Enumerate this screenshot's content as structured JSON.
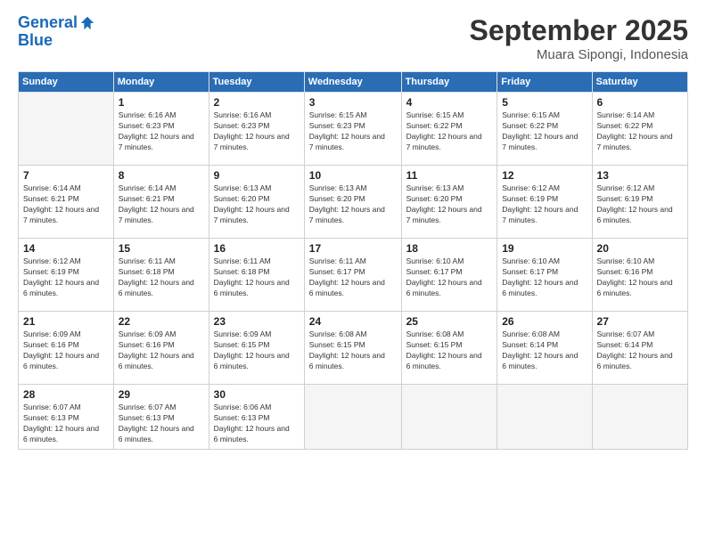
{
  "logo": {
    "line1": "General",
    "line2": "Blue"
  },
  "title": "September 2025",
  "location": "Muara Sipongi, Indonesia",
  "weekdays": [
    "Sunday",
    "Monday",
    "Tuesday",
    "Wednesday",
    "Thursday",
    "Friday",
    "Saturday"
  ],
  "weeks": [
    [
      {
        "day": "",
        "sunrise": "",
        "sunset": "",
        "daylight": ""
      },
      {
        "day": "1",
        "sunrise": "Sunrise: 6:16 AM",
        "sunset": "Sunset: 6:23 PM",
        "daylight": "Daylight: 12 hours and 7 minutes."
      },
      {
        "day": "2",
        "sunrise": "Sunrise: 6:16 AM",
        "sunset": "Sunset: 6:23 PM",
        "daylight": "Daylight: 12 hours and 7 minutes."
      },
      {
        "day": "3",
        "sunrise": "Sunrise: 6:15 AM",
        "sunset": "Sunset: 6:23 PM",
        "daylight": "Daylight: 12 hours and 7 minutes."
      },
      {
        "day": "4",
        "sunrise": "Sunrise: 6:15 AM",
        "sunset": "Sunset: 6:22 PM",
        "daylight": "Daylight: 12 hours and 7 minutes."
      },
      {
        "day": "5",
        "sunrise": "Sunrise: 6:15 AM",
        "sunset": "Sunset: 6:22 PM",
        "daylight": "Daylight: 12 hours and 7 minutes."
      },
      {
        "day": "6",
        "sunrise": "Sunrise: 6:14 AM",
        "sunset": "Sunset: 6:22 PM",
        "daylight": "Daylight: 12 hours and 7 minutes."
      }
    ],
    [
      {
        "day": "7",
        "sunrise": "Sunrise: 6:14 AM",
        "sunset": "Sunset: 6:21 PM",
        "daylight": "Daylight: 12 hours and 7 minutes."
      },
      {
        "day": "8",
        "sunrise": "Sunrise: 6:14 AM",
        "sunset": "Sunset: 6:21 PM",
        "daylight": "Daylight: 12 hours and 7 minutes."
      },
      {
        "day": "9",
        "sunrise": "Sunrise: 6:13 AM",
        "sunset": "Sunset: 6:20 PM",
        "daylight": "Daylight: 12 hours and 7 minutes."
      },
      {
        "day": "10",
        "sunrise": "Sunrise: 6:13 AM",
        "sunset": "Sunset: 6:20 PM",
        "daylight": "Daylight: 12 hours and 7 minutes."
      },
      {
        "day": "11",
        "sunrise": "Sunrise: 6:13 AM",
        "sunset": "Sunset: 6:20 PM",
        "daylight": "Daylight: 12 hours and 7 minutes."
      },
      {
        "day": "12",
        "sunrise": "Sunrise: 6:12 AM",
        "sunset": "Sunset: 6:19 PM",
        "daylight": "Daylight: 12 hours and 7 minutes."
      },
      {
        "day": "13",
        "sunrise": "Sunrise: 6:12 AM",
        "sunset": "Sunset: 6:19 PM",
        "daylight": "Daylight: 12 hours and 6 minutes."
      }
    ],
    [
      {
        "day": "14",
        "sunrise": "Sunrise: 6:12 AM",
        "sunset": "Sunset: 6:19 PM",
        "daylight": "Daylight: 12 hours and 6 minutes."
      },
      {
        "day": "15",
        "sunrise": "Sunrise: 6:11 AM",
        "sunset": "Sunset: 6:18 PM",
        "daylight": "Daylight: 12 hours and 6 minutes."
      },
      {
        "day": "16",
        "sunrise": "Sunrise: 6:11 AM",
        "sunset": "Sunset: 6:18 PM",
        "daylight": "Daylight: 12 hours and 6 minutes."
      },
      {
        "day": "17",
        "sunrise": "Sunrise: 6:11 AM",
        "sunset": "Sunset: 6:17 PM",
        "daylight": "Daylight: 12 hours and 6 minutes."
      },
      {
        "day": "18",
        "sunrise": "Sunrise: 6:10 AM",
        "sunset": "Sunset: 6:17 PM",
        "daylight": "Daylight: 12 hours and 6 minutes."
      },
      {
        "day": "19",
        "sunrise": "Sunrise: 6:10 AM",
        "sunset": "Sunset: 6:17 PM",
        "daylight": "Daylight: 12 hours and 6 minutes."
      },
      {
        "day": "20",
        "sunrise": "Sunrise: 6:10 AM",
        "sunset": "Sunset: 6:16 PM",
        "daylight": "Daylight: 12 hours and 6 minutes."
      }
    ],
    [
      {
        "day": "21",
        "sunrise": "Sunrise: 6:09 AM",
        "sunset": "Sunset: 6:16 PM",
        "daylight": "Daylight: 12 hours and 6 minutes."
      },
      {
        "day": "22",
        "sunrise": "Sunrise: 6:09 AM",
        "sunset": "Sunset: 6:16 PM",
        "daylight": "Daylight: 12 hours and 6 minutes."
      },
      {
        "day": "23",
        "sunrise": "Sunrise: 6:09 AM",
        "sunset": "Sunset: 6:15 PM",
        "daylight": "Daylight: 12 hours and 6 minutes."
      },
      {
        "day": "24",
        "sunrise": "Sunrise: 6:08 AM",
        "sunset": "Sunset: 6:15 PM",
        "daylight": "Daylight: 12 hours and 6 minutes."
      },
      {
        "day": "25",
        "sunrise": "Sunrise: 6:08 AM",
        "sunset": "Sunset: 6:15 PM",
        "daylight": "Daylight: 12 hours and 6 minutes."
      },
      {
        "day": "26",
        "sunrise": "Sunrise: 6:08 AM",
        "sunset": "Sunset: 6:14 PM",
        "daylight": "Daylight: 12 hours and 6 minutes."
      },
      {
        "day": "27",
        "sunrise": "Sunrise: 6:07 AM",
        "sunset": "Sunset: 6:14 PM",
        "daylight": "Daylight: 12 hours and 6 minutes."
      }
    ],
    [
      {
        "day": "28",
        "sunrise": "Sunrise: 6:07 AM",
        "sunset": "Sunset: 6:13 PM",
        "daylight": "Daylight: 12 hours and 6 minutes."
      },
      {
        "day": "29",
        "sunrise": "Sunrise: 6:07 AM",
        "sunset": "Sunset: 6:13 PM",
        "daylight": "Daylight: 12 hours and 6 minutes."
      },
      {
        "day": "30",
        "sunrise": "Sunrise: 6:06 AM",
        "sunset": "Sunset: 6:13 PM",
        "daylight": "Daylight: 12 hours and 6 minutes."
      },
      {
        "day": "",
        "sunrise": "",
        "sunset": "",
        "daylight": ""
      },
      {
        "day": "",
        "sunrise": "",
        "sunset": "",
        "daylight": ""
      },
      {
        "day": "",
        "sunrise": "",
        "sunset": "",
        "daylight": ""
      },
      {
        "day": "",
        "sunrise": "",
        "sunset": "",
        "daylight": ""
      }
    ]
  ]
}
